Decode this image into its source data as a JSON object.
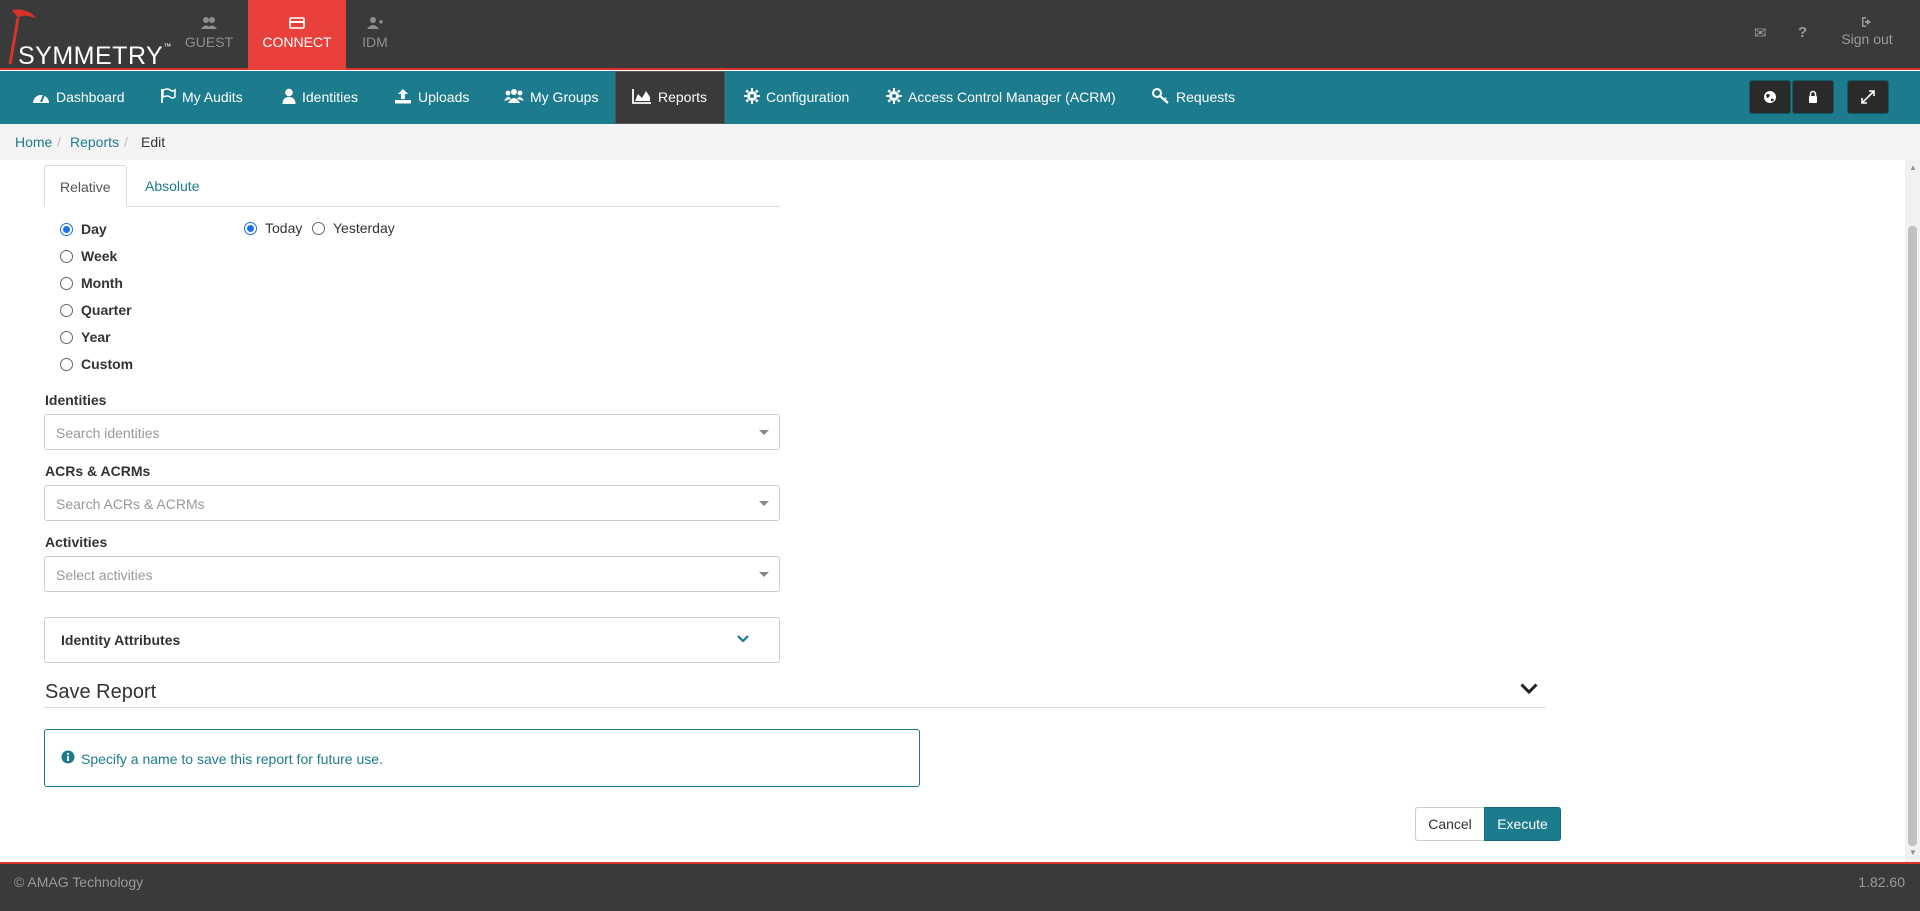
{
  "brand": {
    "name": "SYMMETRY",
    "tm": "™"
  },
  "app_tabs": [
    {
      "label": "GUEST",
      "icon": "users-icon",
      "active": false
    },
    {
      "label": "CONNECT",
      "icon": "card-icon",
      "active": true
    },
    {
      "label": "IDM",
      "icon": "user-plus-icon",
      "active": false
    }
  ],
  "top_right": {
    "signout_label": "Sign out"
  },
  "nav": {
    "items": [
      {
        "label": "Dashboard",
        "icon": "dashboard-icon"
      },
      {
        "label": "My Audits",
        "icon": "flag-icon"
      },
      {
        "label": "Identities",
        "icon": "user-icon"
      },
      {
        "label": "Uploads",
        "icon": "upload-icon"
      },
      {
        "label": "My Groups",
        "icon": "group-icon"
      },
      {
        "label": "Reports",
        "icon": "area-chart-icon",
        "active": true
      },
      {
        "label": "Configuration",
        "icon": "gear-icon"
      },
      {
        "label": "Access Control Manager (ACRM)",
        "icon": "gear-icon"
      },
      {
        "label": "Requests",
        "icon": "key-icon"
      }
    ]
  },
  "breadcrumb": {
    "home": "Home",
    "reports": "Reports",
    "current": "Edit",
    "sep": "/"
  },
  "date_tabs": {
    "relative": "Relative",
    "absolute": "Absolute"
  },
  "period_options": [
    "Day",
    "Week",
    "Month",
    "Quarter",
    "Year",
    "Custom"
  ],
  "selected_period": "Day",
  "day_options": {
    "today": "Today",
    "yesterday": "Yesterday",
    "selected": "Today"
  },
  "filters": {
    "identities": {
      "label": "Identities",
      "placeholder": "Search identities"
    },
    "acrs": {
      "label": "ACRs & ACRMs",
      "placeholder": "Search ACRs & ACRMs"
    },
    "activities": {
      "label": "Activities",
      "placeholder": "Select activities"
    }
  },
  "identity_attributes": {
    "title": "Identity Attributes"
  },
  "save_report": {
    "title": "Save Report",
    "info": "Specify a name to save this report for future use."
  },
  "actions": {
    "cancel": "Cancel",
    "execute": "Execute"
  },
  "footer": {
    "copyright": "© AMAG Technology",
    "version": "1.82.60"
  },
  "colors": {
    "nav": "#1c7b8c",
    "topbar": "#3a3a3a",
    "accent_red": "#e8413b",
    "link": "#1c7b8c"
  }
}
